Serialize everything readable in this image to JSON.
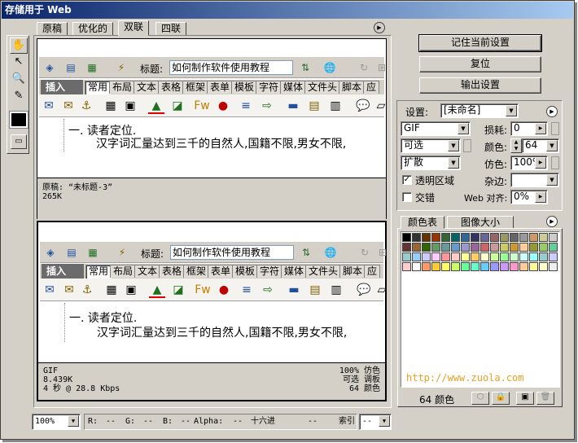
{
  "window": {
    "title": "存储用于 Web",
    "close": "×"
  },
  "tabs": [
    {
      "label": "原稿"
    },
    {
      "label": "优化的"
    },
    {
      "label": "双联"
    },
    {
      "label": "四联"
    }
  ],
  "tools": [
    {
      "icon": "hand-icon",
      "glyph": "✋"
    },
    {
      "icon": "slice-select-icon",
      "glyph": "↖"
    },
    {
      "icon": "zoom-icon",
      "glyph": "🔍"
    },
    {
      "icon": "eyedropper-icon",
      "glyph": "✎"
    }
  ],
  "editor": {
    "title_label": "标题:",
    "title_value": "如何制作软件使用教程",
    "insert_label": "插入",
    "toolbar_tabs": [
      "常用",
      "布局",
      "文本",
      "表格",
      "框架",
      "表单",
      "模板",
      "字符",
      "媒体",
      "文件头",
      "脚本",
      "应"
    ],
    "line1": "一. 读者定位.",
    "line2": "汉字词汇量达到三千的自然人,国籍不限,男女不限,"
  },
  "pane_top": {
    "info1": "原稿: “未标题-3”",
    "info2": "265K"
  },
  "pane_bottom": {
    "info_left": [
      "GIF",
      "8.439K",
      "4 秒 @ 28.8 Kbps"
    ],
    "info_right": [
      "100% 仿色",
      "可选 调板",
      "64 颜色"
    ]
  },
  "buttons": {
    "remember": "记住当前设置",
    "reset": "复位",
    "output": "输出设置"
  },
  "settings": {
    "label": "设置:",
    "preset": "[未命名]",
    "format": "GIF",
    "lossy_label": "损耗:",
    "lossy": "0",
    "palette": "可选",
    "colors_label": "颜色:",
    "colors": "64",
    "dither_algo": "扩散",
    "dither_label": "仿色:",
    "dither": "100%",
    "transparency_label": "透明区域",
    "transparency_checked": true,
    "matte_label": "杂边:",
    "matte": "",
    "interlaced_label": "交错",
    "interlaced_checked": false,
    "web_snap_label": "Web 对齐:",
    "web_snap": "0%"
  },
  "color_table": {
    "tab_colors": "颜色表",
    "tab_size": "图像大小",
    "watermark": "http://www.zuola.com",
    "count": "64 颜色",
    "colors": [
      "#000000",
      "#333333",
      "#663300",
      "#993300",
      "#336633",
      "#006666",
      "#336699",
      "#333366",
      "#666699",
      "#996666",
      "#999966",
      "#666666",
      "#999999",
      "#cc9966",
      "#cccc99",
      "#cccccc",
      "#663333",
      "#996633",
      "#336600",
      "#669966",
      "#669999",
      "#6699cc",
      "#9999cc",
      "#996699",
      "#cc6666",
      "#cc9999",
      "#cccc66",
      "#cc9933",
      "#ffcc99",
      "#999933",
      "#99cc66",
      "#66cc99",
      "#99cccc",
      "#99ccff",
      "#ccccff",
      "#ffccff",
      "#ff9999",
      "#ffcccc",
      "#ffff99",
      "#ffcc66",
      "#ffffcc",
      "#ccff99",
      "#99ff99",
      "#ccffcc",
      "#ccffff",
      "#99ffff",
      "#99cccc",
      "#ccccff",
      "#ffcccc",
      "#ffffff",
      "#ff9966",
      "#ffcc33",
      "#ffff66",
      "#ccff66",
      "#66ff99",
      "#66ffcc",
      "#66ccff",
      "#9999ff",
      "#cc99ff",
      "#ff99cc",
      "#ffcc99",
      "#ffff99",
      "#ffffcc",
      "#eeeeee"
    ]
  },
  "status": {
    "zoom": "100%",
    "r_label": "R:",
    "r": "--",
    "g_label": "G:",
    "g": "--",
    "b_label": "B:",
    "b": "--",
    "alpha_label": "Alpha:",
    "alpha": "--",
    "hex_label": "十六进",
    "hex": "--",
    "index_label": "索引",
    "index": "--"
  }
}
